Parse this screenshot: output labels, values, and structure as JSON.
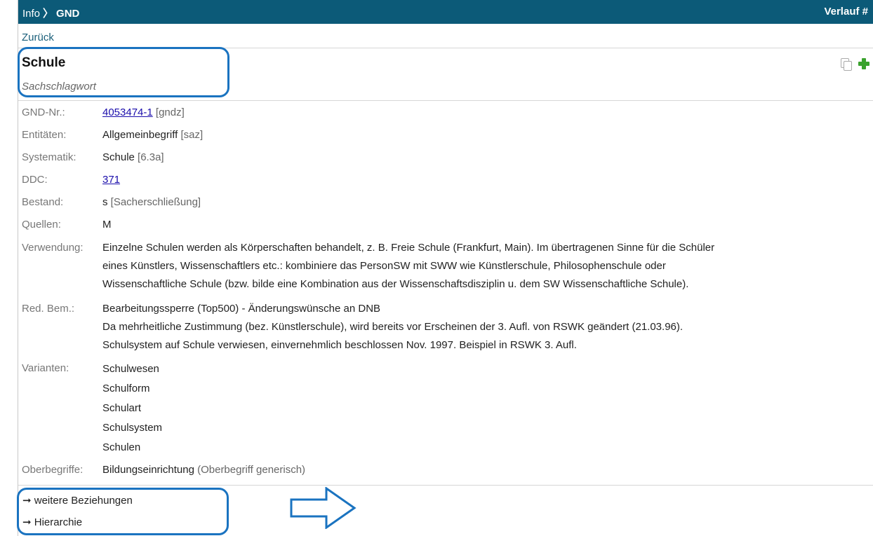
{
  "header": {
    "crumb_root": "Info",
    "crumb_sep": "〉",
    "crumb_current": "GND",
    "history": "Verlauf #"
  },
  "back": "Zurück",
  "record": {
    "title": "Schule",
    "type": "Sachschlagwort"
  },
  "icons": {
    "copy": "copy-icon",
    "add": "plus-icon"
  },
  "fields": {
    "gnd_nr": {
      "label": "GND-Nr.:",
      "value": "4053474-1",
      "suffix": "[gndz]"
    },
    "entitaeten": {
      "label": "Entitäten:",
      "value": "Allgemeinbegriff",
      "suffix": "[saz]"
    },
    "systematik": {
      "label": "Systematik:",
      "value": "Schule",
      "suffix": "[6.3a]"
    },
    "ddc": {
      "label": "DDC:",
      "value": "371"
    },
    "bestand": {
      "label": "Bestand:",
      "value": "s",
      "suffix": "[Sacherschließung]"
    },
    "quellen": {
      "label": "Quellen:",
      "value": "M"
    },
    "verwendung": {
      "label": "Verwendung:",
      "lines": [
        "Einzelne Schulen werden als Körperschaften behandelt, z. B. Freie Schule (Frankfurt, Main). Im übertragenen Sinne für die Schüler",
        "eines Künstlers, Wissenschaftlers etc.: kombiniere das PersonSW mit SWW wie Künstlerschule, Philosophenschule oder",
        "Wissenschaftliche Schule (bzw. bilde eine Kombination aus der Wissenschaftsdisziplin u. dem SW Wissenschaftliche Schule)."
      ]
    },
    "red_bem": {
      "label": "Red. Bem.:",
      "lines": [
        "Bearbeitungssperre (Top500) - Änderungswünsche an DNB",
        "Da mehrheitliche Zustimmung (bez. Künstlerschule), wird bereits vor Erscheinen der 3. Aufl. von RSWK geändert (21.03.96).",
        "Schulsystem auf Schule verwiesen, einvernehmlich beschlossen Nov. 1997. Beispiel in RSWK 3. Aufl."
      ]
    },
    "varianten": {
      "label": "Varianten:",
      "items": [
        "Schulwesen",
        "Schulform",
        "Schulart",
        "Schulsystem",
        "Schulen"
      ]
    },
    "oberbegriffe": {
      "label": "Oberbegriffe:",
      "value": "Bildungseinrichtung",
      "suffix": "(Oberbegriff generisch)"
    }
  },
  "nav": {
    "weitere": "➞ weitere Beziehungen",
    "hierarchie": "➞ Hierarchie"
  },
  "colors": {
    "header_bg": "#0c5a78",
    "highlight": "#1a73c0",
    "link": "#1a0dab",
    "add_green": "#3aa22e"
  }
}
